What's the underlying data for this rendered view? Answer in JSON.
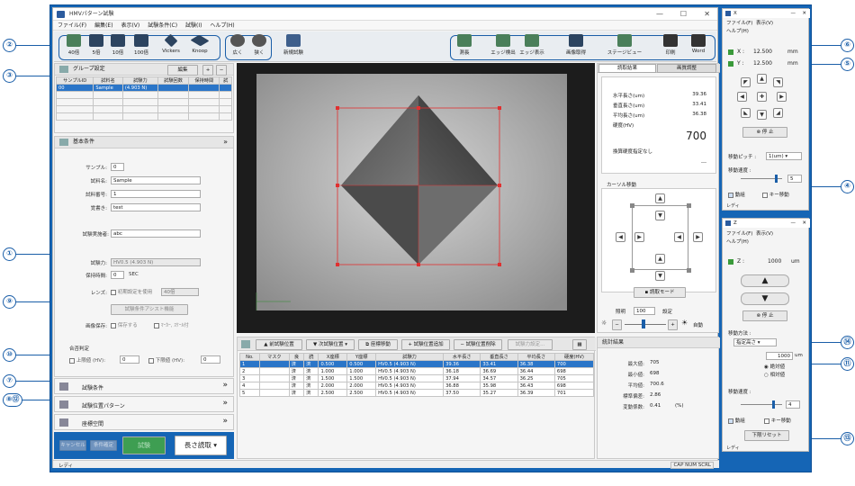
{
  "window": {
    "title": "HMVパターン試験"
  },
  "menu": [
    "ファイル(F)",
    "編集(E)",
    "表示(V)",
    "試験条件(C)",
    "試験(I)",
    "ヘルプ(H)"
  ],
  "toolbar": {
    "objectives": [
      "40倍",
      "5倍",
      "10倍",
      "100倍",
      "Vickers",
      "Knoop"
    ],
    "focus": [
      "広く",
      "狭く"
    ],
    "new_test": "新規試験",
    "right": [
      "測長",
      "エッジ検出",
      "エッジ表示",
      "画像取得",
      "ステージビュー",
      "印刷",
      "Word"
    ]
  },
  "group": {
    "title": "グループ設定",
    "edit": "編集",
    "columns": [
      "サンプルID",
      "試料名",
      "試験力",
      "試験回数",
      "保持時間",
      "試"
    ],
    "row": [
      "00",
      "Sample",
      "(4.903 N)"
    ]
  },
  "basic": {
    "title": "基本条件",
    "sample_label": "サンプル:",
    "sample": "0",
    "name_label": "試料名:",
    "name": "Sample",
    "number_label": "試料番号:",
    "number": "1",
    "memo_label": "覚書き:",
    "memo": "test",
    "tester_label": "試験実施者:",
    "tester": "abc",
    "force_label": "試験力:",
    "force": "HV0.5 (4.903 N)",
    "hold_label": "保持時間:",
    "hold": "0",
    "hold_unit": "SEC",
    "lens_label": "レンズ:",
    "lens_init": "初期設定を使用",
    "lens": "40倍",
    "assist": "試験条件アシスト機能",
    "save_label": "画像保存:",
    "save": "保存する",
    "scale": "ﾏｰｶｰ, ｽｹｰﾙ付",
    "judge_title": "合否判定",
    "upper": "上限値 (HV):",
    "upper_val": "0",
    "lower": "下限値 (HV):",
    "lower_val": "0"
  },
  "sections": [
    "試験条件",
    "試験位置パターン",
    "座標空間"
  ],
  "actions": {
    "cancel": "キャンセル",
    "confirm": "条件確定",
    "test": "試験",
    "read": "長さ読取"
  },
  "results": {
    "tab1": "読取結果",
    "tab2": "画質調整",
    "h_label": "水平長さ(um)",
    "h": "39.36",
    "v_label": "垂直長さ(um)",
    "v": "33.41",
    "avg_label": "平均長さ(um)",
    "avg": "36.38",
    "hv_label": "硬度(HV)",
    "hv": "700",
    "conv": "換算硬度指定なし",
    "conv_val": "---",
    "cursor": "カーソル移動",
    "readmode": "読取モード",
    "light_label": "照明",
    "light": "100",
    "light_btn": "設定",
    "auto": "自動"
  },
  "table": {
    "buttons": [
      "前試験位置",
      "次試験位置",
      "座標移動",
      "試験位置追加",
      "試験位置削除",
      "試験力設定..."
    ],
    "columns": [
      "No.",
      "マスク",
      "良",
      "読",
      "X座標",
      "Y座標",
      "試験力",
      "水平長さ",
      "垂直長さ",
      "平均長さ",
      "硬度(HV)"
    ],
    "rows": [
      [
        "1",
        "",
        "済",
        "済",
        "0.500",
        "0.500",
        "HV0.5 (4.903 N)",
        "39.36",
        "33.41",
        "36.38",
        "700"
      ],
      [
        "2",
        "",
        "済",
        "済",
        "1.000",
        "1.000",
        "HV0.5 (4.903 N)",
        "36.18",
        "36.69",
        "36.44",
        "698"
      ],
      [
        "3",
        "",
        "済",
        "済",
        "1.500",
        "1.500",
        "HV0.5 (4.903 N)",
        "37.94",
        "34.57",
        "36.25",
        "705"
      ],
      [
        "4",
        "",
        "済",
        "済",
        "2.000",
        "2.000",
        "HV0.5 (4.903 N)",
        "36.88",
        "35.98",
        "36.43",
        "698"
      ],
      [
        "5",
        "",
        "済",
        "済",
        "2.500",
        "2.500",
        "HV0.5 (4.903 N)",
        "37.50",
        "35.27",
        "36.39",
        "701"
      ]
    ]
  },
  "stats": {
    "title": "統計結果",
    "max_label": "最大値:",
    "max": "705",
    "min_label": "最小値:",
    "min": "698",
    "mean_label": "平均値:",
    "mean": "700.6",
    "sd_label": "標準偏差:",
    "sd": "2.86",
    "cv_label": "変動係数:",
    "cv": "0.41",
    "cv_unit": "(%)"
  },
  "xy": {
    "title": "X",
    "menu": [
      "ファイル(F)",
      "表示(V)",
      "ヘルプ(H)"
    ],
    "x_label": "X :",
    "x": "12.500",
    "y_label": "Y :",
    "y": "12.500",
    "unit": "mm",
    "stop": "停 止",
    "pitch_label": "移動ピッチ :",
    "pitch": "1(um)",
    "speed_label": "移動速度 :",
    "speed": "5",
    "check1": "動組",
    "check2": "キー移動",
    "footer": "レディ"
  },
  "z": {
    "title": "Z",
    "menu": [
      "ファイル(F)",
      "表示(V)",
      "ヘルプ(H)"
    ],
    "z_label": "Z :",
    "z": "1000",
    "unit": "um",
    "stop": "停 止",
    "method_label": "移動方法 :",
    "method": "指定高さ",
    "height": "1000",
    "height_unit": "um",
    "opt1": "絶対値",
    "opt2": "相対値",
    "speed_label": "移動速度 :",
    "speed": "4",
    "check1": "動組",
    "check2": "キー移動",
    "limit": "下限リセット",
    "footer": "レディ"
  },
  "statusbar": {
    "left": "レディ",
    "right": "CAP NUM SCRL"
  },
  "callouts": [
    "①",
    "②",
    "③",
    "④",
    "⑤",
    "⑥",
    "⑦",
    "⑧",
    "⑨",
    "⑩",
    "⑪",
    "⑫",
    "⑬",
    "⑭"
  ]
}
